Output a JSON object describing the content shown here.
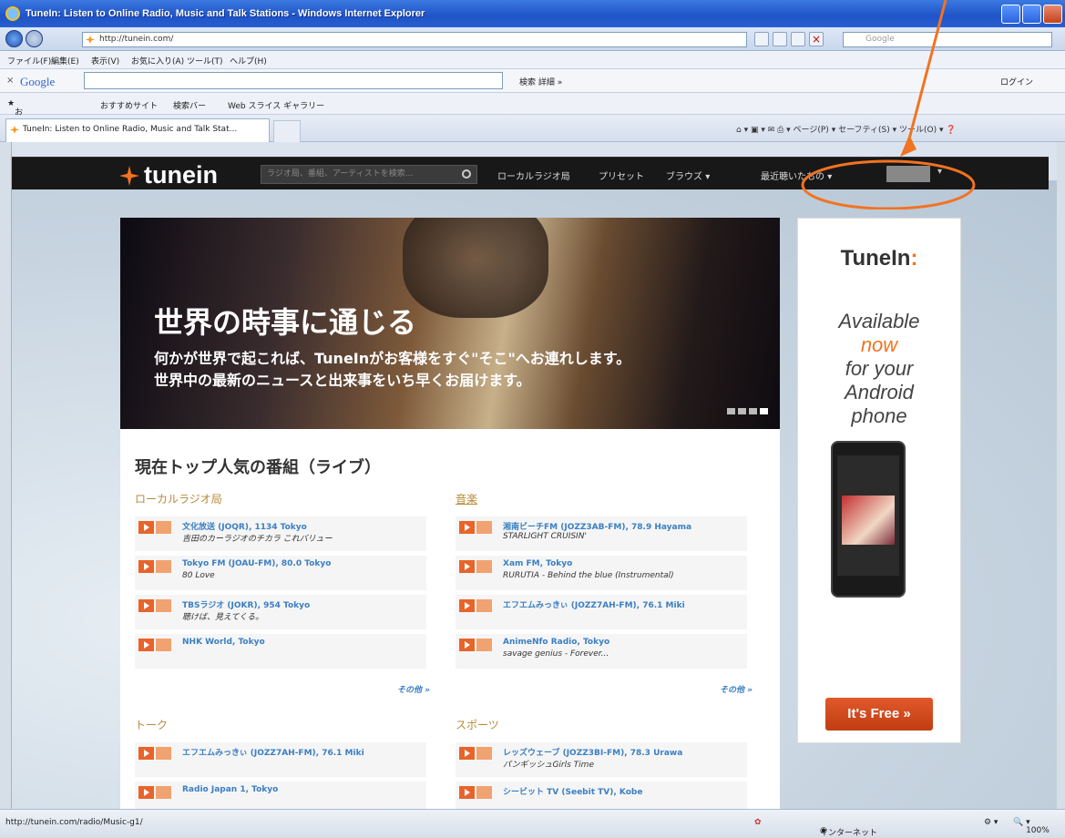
{
  "browser": {
    "title": "TuneIn: Listen to Online Radio, Music and Talk Stations - Windows Internet Explorer",
    "url": "http://tunein.com/",
    "search_placeholder": "Google",
    "menu": [
      "ファイル(F)",
      "編集(E)",
      "表示(V)",
      "お気に入り(A)",
      "ツール(T)",
      "ヘルプ(H)"
    ],
    "google_bar": {
      "logo": "Google",
      "search_btn": "検索",
      "more": "詳細 »",
      "login": "ログイン"
    },
    "favorites": {
      "label": "お気に入り",
      "suggested": "おすすめサイト",
      "search_bar": "検索バー",
      "gallery": "Web スライス ギャラリー"
    },
    "tab_title": "TuneIn: Listen to Online Radio, Music and Talk Stat...",
    "commands": [
      "ページ(P)",
      "セーフティ(S)",
      "ツール(O)"
    ],
    "status_url": "http://tunein.com/radio/Music-g1/",
    "zone": "インターネット",
    "zoom": "100%"
  },
  "tunein_nav": {
    "logo": "tunein",
    "search_placeholder": "ラジオ局、番組、アーティストを検索...",
    "items": [
      "ローカルラジオ局",
      "プリセット",
      "ブラウズ",
      "最近聴いたもの"
    ]
  },
  "hero": {
    "headline": "世界の時事に通じる",
    "sub_line1": "何かが世界で起これば、TuneInがお客様をすぐ\"そこ\"へお連れします。",
    "sub_line2": "世界中の最新のニュースと出来事をいち早くお届けます。",
    "slides": 4
  },
  "ad": {
    "brand": "TuneIn",
    "brand_colon": ":",
    "line1": "Available",
    "line2": "now",
    "line3": "for your",
    "line4": "Android",
    "line5": "phone",
    "cta": "It's Free »"
  },
  "content": {
    "title": "現在トップ人気の番組（ライブ）",
    "sections": [
      {
        "name": "ローカルラジオ局",
        "rows": [
          {
            "station": "文化放送 (JOQR), 1134 Tokyo",
            "program": "吉田のカーラジオのチカラ これバリュー"
          },
          {
            "station": "Tokyo FM (JOAU-FM), 80.0 Tokyo",
            "program": "80 Love"
          },
          {
            "station": "TBSラジオ (JOKR), 954 Tokyo",
            "program": "聴けば、見えてくる。"
          },
          {
            "station": "NHK World, Tokyo",
            "program": ""
          }
        ],
        "more": "その他 »"
      },
      {
        "name": "音楽",
        "rows": [
          {
            "station": "湘南ビーチFM (JOZZ3AB-FM), 78.9 Hayama",
            "program": "STARLIGHT CRUISIN'"
          },
          {
            "station": "Xam FM, Tokyo",
            "program": "RURUTIA - Behind the blue (Instrumental)"
          },
          {
            "station": "エフエムみっきぃ (JOZZ7AH-FM), 76.1 Miki",
            "program": ""
          },
          {
            "station": "AnimeNfo Radio, Tokyo",
            "program": "savage genius - Forever..."
          }
        ],
        "more": "その他 »"
      },
      {
        "name": "トーク",
        "rows": [
          {
            "station": "エフエムみっきぃ (JOZZ7AH-FM), 76.1 Miki",
            "program": ""
          },
          {
            "station": "Radio Japan 1, Tokyo",
            "program": ""
          }
        ]
      },
      {
        "name": "スポーツ",
        "rows": [
          {
            "station": "レッズウェーブ (JOZZ3BI-FM), 78.3 Urawa",
            "program": "パンギッシュGirls Time"
          },
          {
            "station": "シービット TV (Seebit TV), Kobe",
            "program": ""
          }
        ]
      }
    ]
  },
  "colors": {
    "accent": "#f27321",
    "link": "#3a7fc4",
    "nav_bg": "#181818",
    "annotation": "#f27321"
  }
}
